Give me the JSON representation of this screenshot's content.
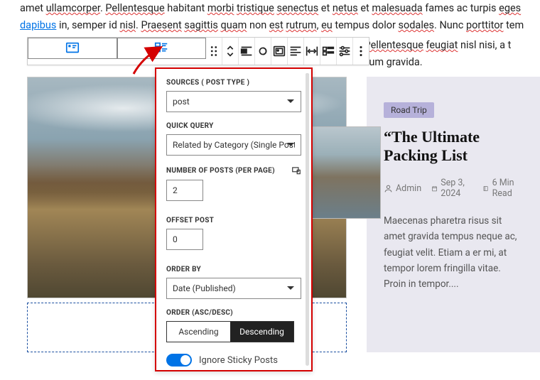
{
  "editor_html": "amet <span class='sp'>ullamcorper</span>. <span class='sp'>Pellentesque</span> habitant <span class='sp'>morbi</span> <span class='sp'>tristique</span> <span class='sp'>senectus</span> et <span class='sp'>netus</span> et <span class='sp'>malesuada</span> fames ac turpis <span class='sp'>eges</span> <a>dapibus</a> in, semper id <span class='sp'>nisl</span>. <span class='sp'>Praesent</span> <span class='sp'>sagittis</span> <span class='sp'>quam</span> non <span class='sp'>est</span> <span class='sp'>rutrum</span>, <span class='sp'>eu</span> tempus dolor <span class='sp'>sodales</span>. Nunc <span class='sp'>porttitor</span> tem <span style='display:block;padding-left:430px;margin-top:4px'><span class='sp'>esuada</span>. <span class='sp'>Pellentesque</span> <span class='sp'>feugiat</span> nisl nisi, a t</span><span style='display:block;padding-left:430px'>e vestibulum gravida.</span>",
  "popover": {
    "labels": {
      "sources": "SOURCES ( POST TYPE )",
      "quick_query": "QUICK QUERY",
      "num_posts": "NUMBER OF POSTS (PER PAGE)",
      "offset": "OFFSET POST",
      "order_by": "ORDER BY",
      "order": "ORDER (ASC/DESC)"
    },
    "values": {
      "sources": "post",
      "quick_query": "Related by Category (Single Post)",
      "num_posts": "2",
      "offset": "0",
      "order_by": "Date (Published)"
    },
    "order_opts": {
      "asc": "Ascending",
      "desc": "Descending"
    },
    "sticky_label": "Ignore Sticky Posts"
  },
  "card": {
    "tag": "Road Trip",
    "title": "“The Ultimate Packing List",
    "author": "Admin",
    "date": "Sep 3, 2024",
    "read": "6 Min Read",
    "excerpt": "Maecenas pharetra risus sit amet gravida tempus neque ac, feugiat velit. Etiam a er mi, at tempor lorem fringilla vitae. Proin in tempor...."
  }
}
